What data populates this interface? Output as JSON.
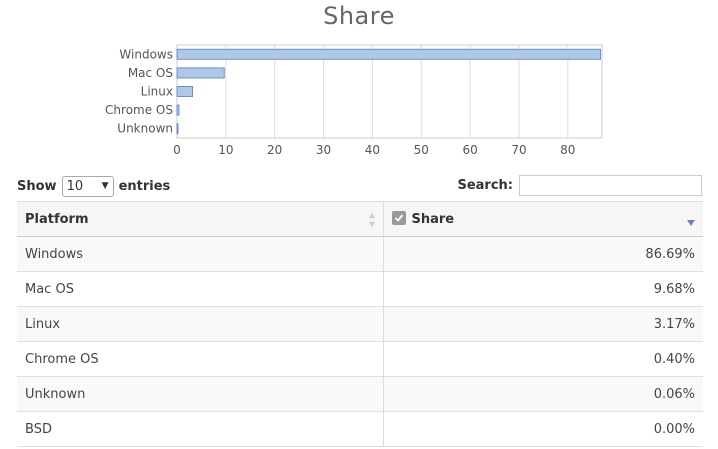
{
  "chart_data": {
    "type": "bar",
    "orientation": "horizontal",
    "title": "Share",
    "categories": [
      "Windows",
      "Mac OS",
      "Linux",
      "Chrome OS",
      "Unknown"
    ],
    "values": [
      86.69,
      9.68,
      3.17,
      0.4,
      0.06
    ],
    "xlim": [
      0,
      87
    ],
    "xticks": [
      0,
      10,
      20,
      30,
      40,
      50,
      60,
      70,
      80
    ],
    "grid": true,
    "bar_color": "#b0c8e8",
    "bar_stroke": "#6b8fc7"
  },
  "controls": {
    "show_label": "Show",
    "entries_value": "10",
    "entries_label": "entries",
    "search_label": "Search:",
    "search_value": ""
  },
  "table": {
    "columns": [
      "Platform",
      "Share"
    ],
    "rows": [
      [
        "Windows",
        "86.69%"
      ],
      [
        "Mac OS",
        "9.68%"
      ],
      [
        "Linux",
        "3.17%"
      ],
      [
        "Chrome OS",
        "0.40%"
      ],
      [
        "Unknown",
        "0.06%"
      ],
      [
        "BSD",
        "0.00%"
      ]
    ]
  }
}
